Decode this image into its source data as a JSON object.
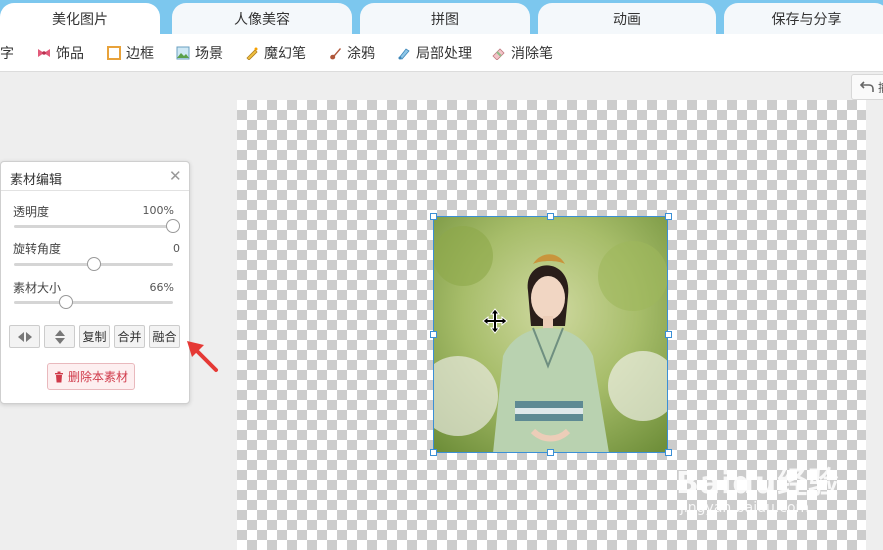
{
  "tabs": [
    {
      "label": "美化图片",
      "active": true
    },
    {
      "label": "人像美容",
      "active": false
    },
    {
      "label": "拼图",
      "active": false
    },
    {
      "label": "动画",
      "active": false
    },
    {
      "label": "保存与分享",
      "active": false
    }
  ],
  "toolbar": {
    "items": [
      {
        "label": "字",
        "icon": "text-icon"
      },
      {
        "label": "饰品",
        "icon": "bow-icon"
      },
      {
        "label": "边框",
        "icon": "frame-icon"
      },
      {
        "label": "场景",
        "icon": "scene-icon"
      },
      {
        "label": "魔幻笔",
        "icon": "magic-pen-icon"
      },
      {
        "label": "涂鸦",
        "icon": "brush-icon"
      },
      {
        "label": "局部处理",
        "icon": "local-edit-icon"
      },
      {
        "label": "消除笔",
        "icon": "eraser-pen-icon"
      }
    ]
  },
  "panel": {
    "title": "素材编辑",
    "sliders": [
      {
        "label": "透明度",
        "value_text": "100%",
        "fraction": 1.0
      },
      {
        "label": "旋转角度",
        "value_text": "0",
        "fraction": 0.5
      },
      {
        "label": "素材大小",
        "value_text": "66%",
        "fraction": 0.33
      }
    ],
    "buttons": {
      "copy": "复制",
      "merge": "合并",
      "blend": "融合"
    },
    "delete_label": "删除本素材"
  },
  "watermark": {
    "brand": "Baidu经验",
    "url": "jingyan.baidu.com"
  },
  "colors": {
    "tab_bar": "#7cc7ee",
    "selection": "#3a8fd6",
    "arrow": "#e53935",
    "delete_text": "#d03a4a"
  }
}
